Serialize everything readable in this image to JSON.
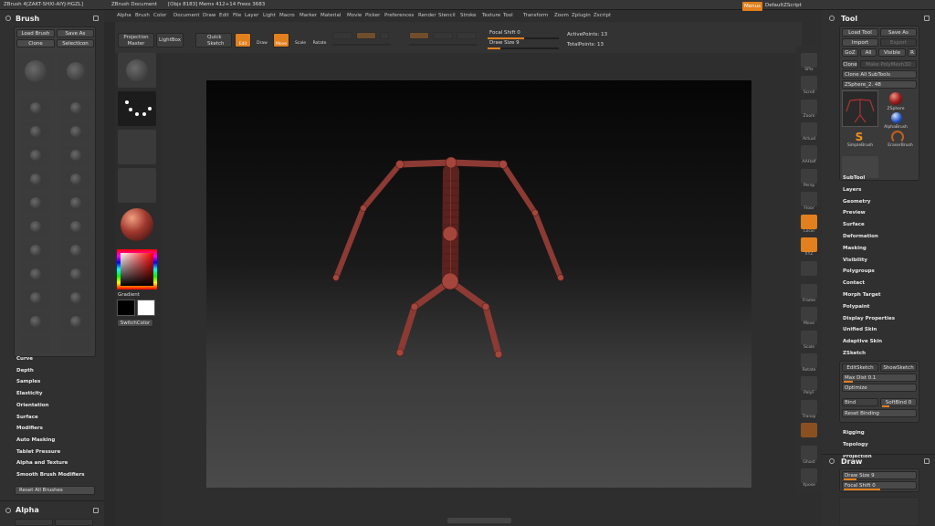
{
  "titlebar": {
    "app": "ZBrush 4[ZAKT-SHXI-AIYJ-HGZL]",
    "document": "ZBrush Document",
    "objinfo": "[Objs 8183] Mems 412+14 Frees 3683"
  },
  "menubar": {
    "items": [
      "Alpha",
      "Brush",
      "Color",
      "Document",
      "Draw",
      "Edit",
      "File",
      "Layer",
      "Light",
      "Macro",
      "Marker",
      "Material",
      "Movie",
      "Picker",
      "Preferences",
      "Render",
      "Stencil",
      "Stroke",
      "Texture",
      "Tool",
      "Transform",
      "Zoom",
      "Zplugin",
      "Zscript"
    ],
    "menus_btn": "Menus",
    "default_script": "DefaultZScript"
  },
  "brush_panel": {
    "title": "Brush",
    "load": "Load Brush",
    "save_as": "Save As",
    "clone": "Clone",
    "select_icon": "SelectIcon",
    "sections": [
      "Curve",
      "Depth",
      "Samples",
      "Elasticity",
      "Orientation",
      "Surface",
      "Modifiers",
      "Auto Masking",
      "Tablet Pressure",
      "Alpha and Texture",
      "Smooth Brush Modifiers"
    ],
    "reset": "Reset All Brushes",
    "alpha_title": "Alpha"
  },
  "left_column": {
    "gradient": "Gradient",
    "switch_color": "SwitchColor"
  },
  "toolbar": {
    "projection_master": "Projection Master",
    "lightbox": "LightBox",
    "quick_sketch": "Quick Sketch",
    "edit": "Edit",
    "draw": "Draw",
    "move": "Move",
    "scale": "Scale",
    "rotate": "Rotate",
    "focal_shift": "Focal Shift 0",
    "draw_size": "Draw Size 9",
    "active_points": "ActivePoints: 13",
    "total_points": "TotalPoints: 13"
  },
  "shelf": {
    "items": [
      "SPix",
      "Scroll",
      "Zoom",
      "Actual",
      "AAHalf",
      "Persp",
      "Floor",
      "Local",
      "XYZ",
      "",
      "Frame",
      "Move",
      "Scale",
      "Rotate",
      "PolyF",
      "Transp",
      "",
      "Ghost",
      "Xpose"
    ]
  },
  "tool_panel": {
    "title": "Tool",
    "load": "Load Tool",
    "save_as": "Save As",
    "import": "Import",
    "export": "Export",
    "goz": "GoZ",
    "all": "All",
    "visible": "Visible",
    "r": "R",
    "clone": "Clone",
    "make_poly": "Make PolyMesh3D",
    "clone_all": "Clone All SubTools",
    "zsphere": "ZSphere_2. 48",
    "thumbs": [
      "ZSphere",
      "SimpleBrush",
      "AlphaBrush",
      "EraserBrush"
    ],
    "subtool_items": [
      "SubTool",
      "Layers",
      "Geometry",
      "Preview",
      "Surface",
      "Deformation",
      "Masking",
      "Visibility",
      "Polygroups",
      "Contact",
      "Morph Target",
      "Polypaint",
      "Display Properties",
      "Unified Skin",
      "Adaptive Skin",
      "ZSketch"
    ],
    "edit_sketch": "EditSketch",
    "show_sketch": "ShowSketch",
    "max_dist": "Max Dist 0.1",
    "optimize": "Optimize",
    "bind": "Bind",
    "soft_bind": "SoftBind 0",
    "reset_binding": "Reset Binding",
    "after_items": [
      "Rigging",
      "Topology",
      "Projection"
    ],
    "draw_title": "Draw",
    "draw_size": "Draw Size 9",
    "focal_shift": "Focal Shift 0"
  },
  "colors": {
    "accent": "#e2801d",
    "figure": "#8c3a33",
    "panel": "#333333"
  }
}
